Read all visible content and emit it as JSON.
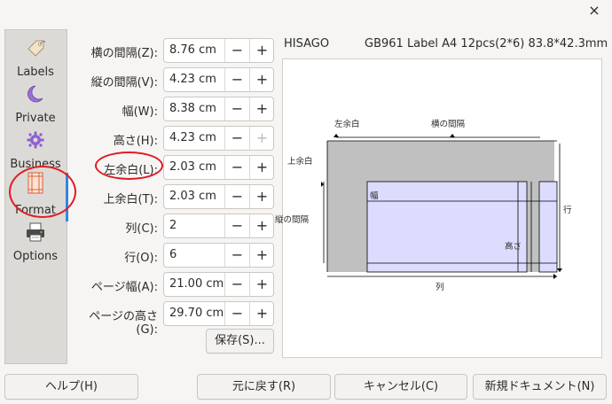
{
  "window": {
    "close_glyph": "×"
  },
  "sidebar": {
    "items": [
      {
        "label": "Labels",
        "icon": "label-tag-icon"
      },
      {
        "label": "Private",
        "icon": "moon-icon"
      },
      {
        "label": "Business",
        "icon": "gear-icon"
      },
      {
        "label": "Format",
        "icon": "format-page-icon",
        "active": true
      },
      {
        "label": "Options",
        "icon": "printer-icon"
      }
    ]
  },
  "form": {
    "fields": [
      {
        "label": "横の間隔(Z):",
        "value": "8.76 cm"
      },
      {
        "label": "縦の間隔(V):",
        "value": "4.23 cm"
      },
      {
        "label": "幅(W):",
        "value": "8.38 cm"
      },
      {
        "label": "高さ(H):",
        "value": "4.23 cm"
      },
      {
        "label": "左余白(L):",
        "value": "2.03 cm"
      },
      {
        "label": "上余白(T):",
        "value": "2.03 cm"
      },
      {
        "label": "列(C):",
        "value": "2"
      },
      {
        "label": "行(O):",
        "value": "6"
      },
      {
        "label": "ページ幅(A):",
        "value": "21.00 cm"
      },
      {
        "label": "ページの高さ(G):",
        "value": "29.70 cm"
      }
    ],
    "minus_glyph": "−",
    "plus_glyph": "+",
    "save_label": "保存(S)..."
  },
  "preview": {
    "brand": "HISAGO",
    "product": "GB961 Label A4 12pcs(2*6) 83.8*42.3mm",
    "labels": {
      "left_margin": "左余白",
      "h_spacing": "横の間隔",
      "top_margin": "上余白",
      "v_spacing": "縦の間隔",
      "width": "幅",
      "height": "高さ",
      "row": "行",
      "column": "列"
    },
    "colors": {
      "page": "#c0c0c0",
      "label_fill": "#dcdcff",
      "line": "#000000"
    }
  },
  "footer": {
    "help": "ヘルプ(H)",
    "reset": "元に戻す(R)",
    "cancel": "キャンセル(C)",
    "new_document": "新規ドキュメント(N)"
  },
  "annotation_color": "#e01b24"
}
